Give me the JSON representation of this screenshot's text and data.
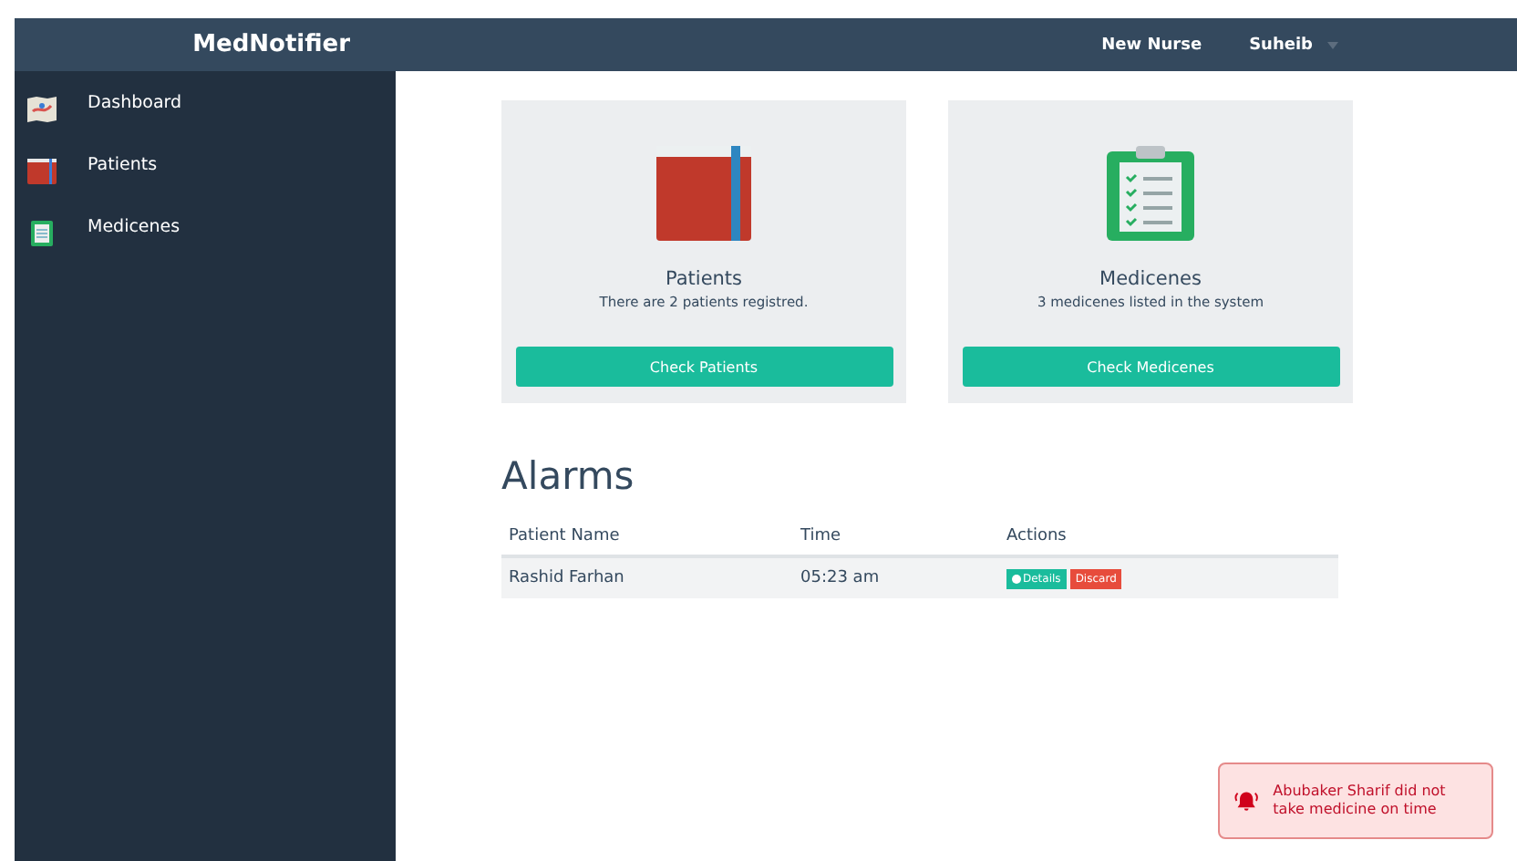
{
  "navbar": {
    "brand": "MedNotifier",
    "links": [
      {
        "label": "New Nurse",
        "dropdown": false
      },
      {
        "label": "Suheib",
        "dropdown": true
      }
    ]
  },
  "sidebar": {
    "items": [
      {
        "label": "Dashboard",
        "kind": "map"
      },
      {
        "label": "Patients",
        "kind": "book"
      },
      {
        "label": "Medicenes",
        "kind": "clipboard"
      }
    ]
  },
  "cards": [
    {
      "kind": "book",
      "title": "Patients",
      "text": "There are 2 patients registred.",
      "button": "Check Patients"
    },
    {
      "kind": "clipboard",
      "title": "Medicenes",
      "text": "3 medicenes listed in the system",
      "button": "Check Medicenes"
    }
  ],
  "alarms": {
    "title": "Alarms",
    "columns": [
      "Patient Name",
      "Time",
      "Actions"
    ],
    "rows": [
      {
        "patient": "Rashid Farhan",
        "time": "05:23 am",
        "actions": [
          "Details",
          "Discard"
        ]
      }
    ]
  },
  "notification": {
    "text": "Abubaker Sharif did not take medicine on time"
  }
}
